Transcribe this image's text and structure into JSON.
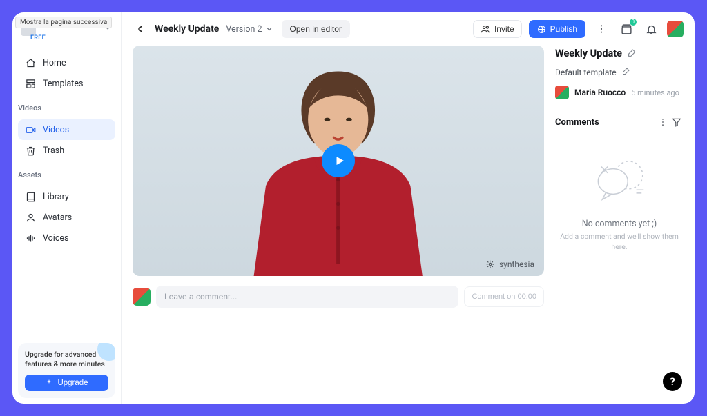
{
  "tooltip": "Mostra la pagina successiva",
  "plan_tag": "FREE",
  "sidebar": {
    "nav": [
      {
        "label": "Home"
      },
      {
        "label": "Templates"
      }
    ],
    "videos_heading": "Videos",
    "videos": [
      {
        "label": "Videos",
        "active": true
      },
      {
        "label": "Trash"
      }
    ],
    "assets_heading": "Assets",
    "assets": [
      {
        "label": "Library"
      },
      {
        "label": "Avatars"
      },
      {
        "label": "Voices"
      }
    ],
    "upgrade_text": "Upgrade for advanced features & more minutes",
    "upgrade_button": "Upgrade"
  },
  "topbar": {
    "title": "Weekly Update",
    "version": "Version 2",
    "open_editor": "Open in editor",
    "invite": "Invite",
    "publish": "Publish",
    "updates_count": "0"
  },
  "video": {
    "brand": "synthesia"
  },
  "comment_box": {
    "placeholder": "Leave a comment...",
    "timestamp_button": "Comment on 00:00"
  },
  "side": {
    "title": "Weekly Update",
    "template": "Default template",
    "author": "Maria Ruocco",
    "time_ago": "5 minutes ago",
    "comments_label": "Comments",
    "empty_title": "No comments yet ;)",
    "empty_sub": "Add a comment and we'll show them here."
  },
  "help": "?"
}
